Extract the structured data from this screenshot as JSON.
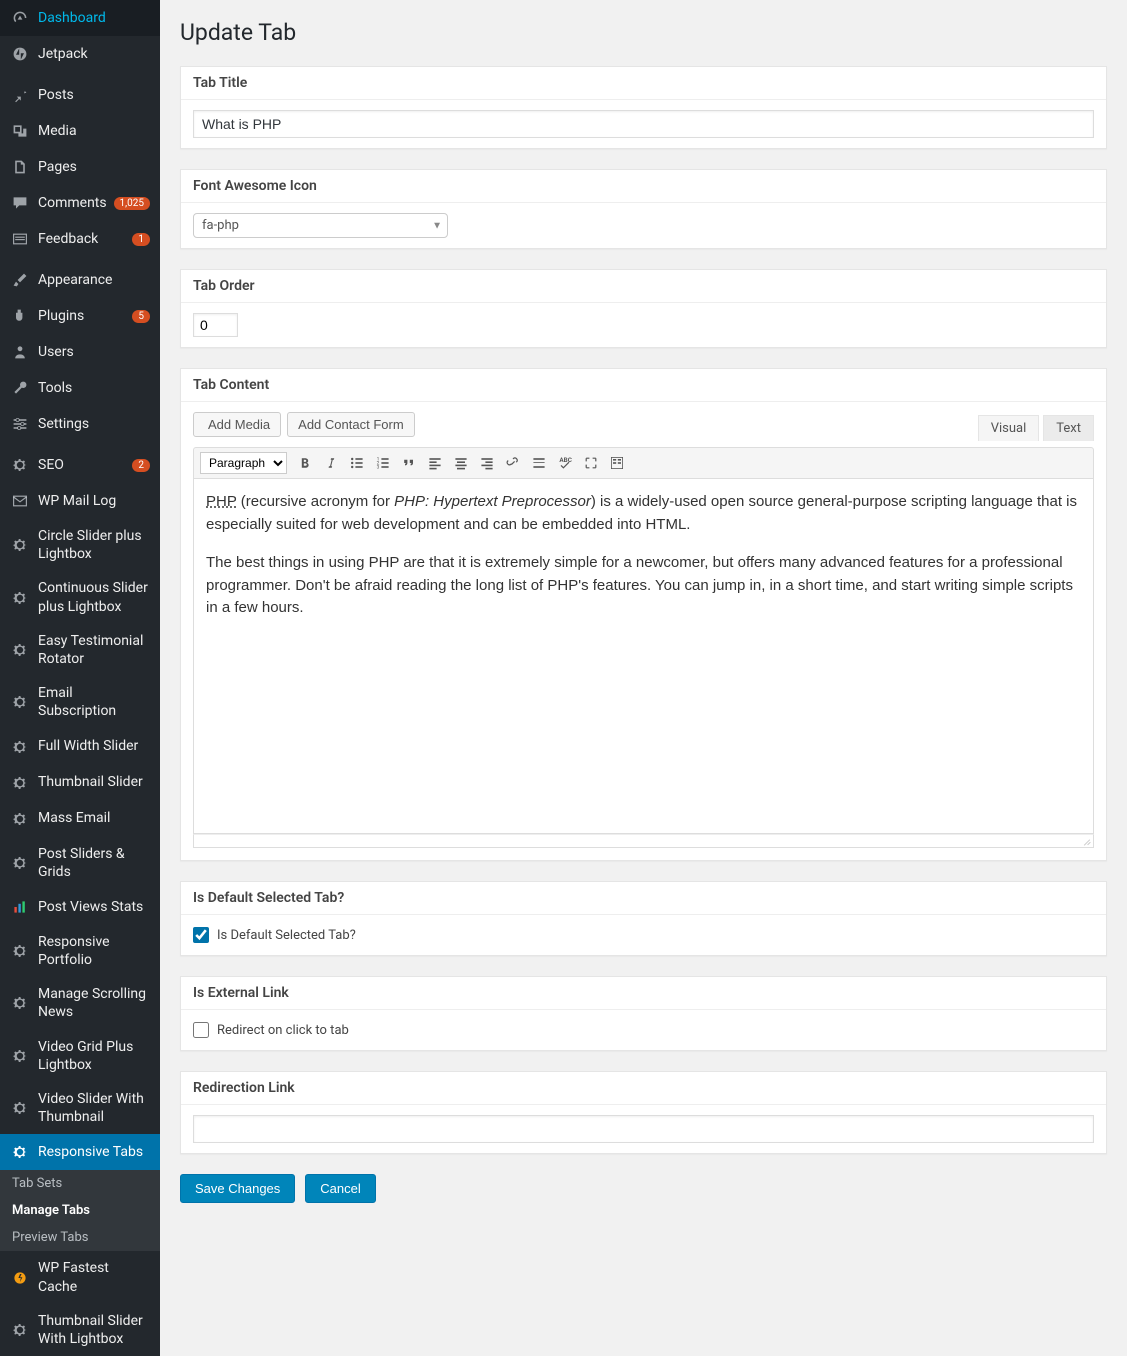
{
  "sidebar": {
    "items": [
      {
        "label": "Dashboard",
        "icon": "dashboard"
      },
      {
        "label": "Jetpack",
        "icon": "jetpack"
      },
      {
        "label": "Posts",
        "icon": "pin",
        "sep_before": true
      },
      {
        "label": "Media",
        "icon": "media"
      },
      {
        "label": "Pages",
        "icon": "page"
      },
      {
        "label": "Comments",
        "icon": "comment",
        "badge": "1,025"
      },
      {
        "label": "Feedback",
        "icon": "feedback",
        "badge": "1"
      },
      {
        "label": "Appearance",
        "icon": "brush",
        "sep_before": true
      },
      {
        "label": "Plugins",
        "icon": "plugin",
        "badge": "5"
      },
      {
        "label": "Users",
        "icon": "user"
      },
      {
        "label": "Tools",
        "icon": "wrench"
      },
      {
        "label": "Settings",
        "icon": "sliders"
      },
      {
        "label": "SEO",
        "icon": "gear",
        "badge": "2",
        "sep_before": true
      },
      {
        "label": "WP Mail Log",
        "icon": "mail"
      },
      {
        "label": "Circle Slider plus Lightbox",
        "icon": "gear"
      },
      {
        "label": "Continuous Slider plus Lightbox",
        "icon": "gear"
      },
      {
        "label": "Easy Testimonial Rotator",
        "icon": "gear"
      },
      {
        "label": "Email Subscription",
        "icon": "gear"
      },
      {
        "label": "Full Width Slider",
        "icon": "gear"
      },
      {
        "label": "Thumbnail Slider",
        "icon": "gear"
      },
      {
        "label": "Mass Email",
        "icon": "gear"
      },
      {
        "label": "Post Sliders & Grids",
        "icon": "gear"
      },
      {
        "label": "Post Views Stats",
        "icon": "chart"
      },
      {
        "label": "Responsive Portfolio",
        "icon": "gear"
      },
      {
        "label": "Manage Scrolling News",
        "icon": "gear"
      },
      {
        "label": "Video Grid Plus Lightbox",
        "icon": "gear"
      },
      {
        "label": "Video Slider With Thumbnail",
        "icon": "gear"
      },
      {
        "label": "Responsive Tabs",
        "icon": "gear",
        "active": true,
        "subitems": [
          "Tab Sets",
          "Manage Tabs",
          "Preview Tabs"
        ],
        "subcurrent": 1
      },
      {
        "label": "WP Fastest Cache",
        "icon": "cache"
      },
      {
        "label": "Thumbnail Slider With Lightbox",
        "icon": "gear"
      }
    ]
  },
  "page": {
    "title": "Update Tab",
    "sections": {
      "tab_title": {
        "heading": "Tab Title",
        "value": "What is PHP"
      },
      "icon": {
        "heading": "Font Awesome Icon",
        "value": "fa-php"
      },
      "order": {
        "heading": "Tab Order",
        "value": "0"
      },
      "content": {
        "heading": "Tab Content",
        "add_media": "Add Media",
        "add_contact": "Add Contact Form",
        "tabs": {
          "visual": "Visual",
          "text": "Text"
        },
        "format": "Paragraph",
        "body_p1_php": "PHP",
        "body_p1_before": " (recursive acronym for ",
        "body_p1_em": "PHP: Hypertext Preprocessor",
        "body_p1_after": ") is a widely-used open source general-purpose scripting language that is especially suited for web development and can be embedded into HTML.",
        "body_p2": "The best things in using PHP are that it is extremely simple for a newcomer, but offers many advanced features for a professional programmer. Don't be afraid reading the long list of PHP's features. You can jump in, in a short time, and start writing simple scripts in a few hours."
      },
      "default_tab": {
        "heading": "Is Default Selected Tab?",
        "label": "Is Default Selected Tab?",
        "checked": true
      },
      "external": {
        "heading": "Is External Link",
        "label": "Redirect on click to tab",
        "checked": false
      },
      "redirect": {
        "heading": "Redirection Link",
        "value": ""
      }
    },
    "actions": {
      "save": "Save Changes",
      "cancel": "Cancel"
    }
  }
}
